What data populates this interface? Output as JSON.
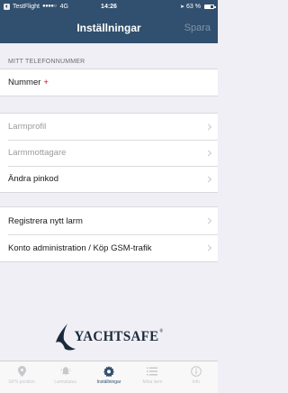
{
  "status_bar": {
    "carrier": "TestFlight",
    "signal": "●●●●○",
    "network": "4G",
    "time": "14:26",
    "battery": "63 %"
  },
  "nav": {
    "title": "Inställningar",
    "save_label": "Spara"
  },
  "phone_section": {
    "header": "MITT TELEFONNUMMER",
    "number_label": "Nummer",
    "required_mark": "+"
  },
  "settings_group": [
    {
      "label": "Larmprofil",
      "disabled": true
    },
    {
      "label": "Larmmottagare",
      "disabled": true
    },
    {
      "label": "Ändra pinkod",
      "disabled": false
    }
  ],
  "account_group": [
    {
      "label": "Registrera nytt larm"
    },
    {
      "label": "Konto administration / Köp GSM-trafik"
    }
  ],
  "logo": {
    "text": "YACHTSAFE",
    "trademark": "®"
  },
  "tabs": [
    {
      "label": "GPS-position",
      "icon": "location-pin-icon",
      "active": false
    },
    {
      "label": "Larmstatus",
      "icon": "alarm-bell-icon",
      "active": false
    },
    {
      "label": "Inställningar",
      "icon": "gear-icon",
      "active": true
    },
    {
      "label": "Mina larm",
      "icon": "list-icon",
      "active": false
    },
    {
      "label": "Info",
      "icon": "info-icon",
      "active": false
    }
  ],
  "colors": {
    "brand": "#314f6e",
    "required": "#d0021b",
    "background": "#f0eff5"
  }
}
